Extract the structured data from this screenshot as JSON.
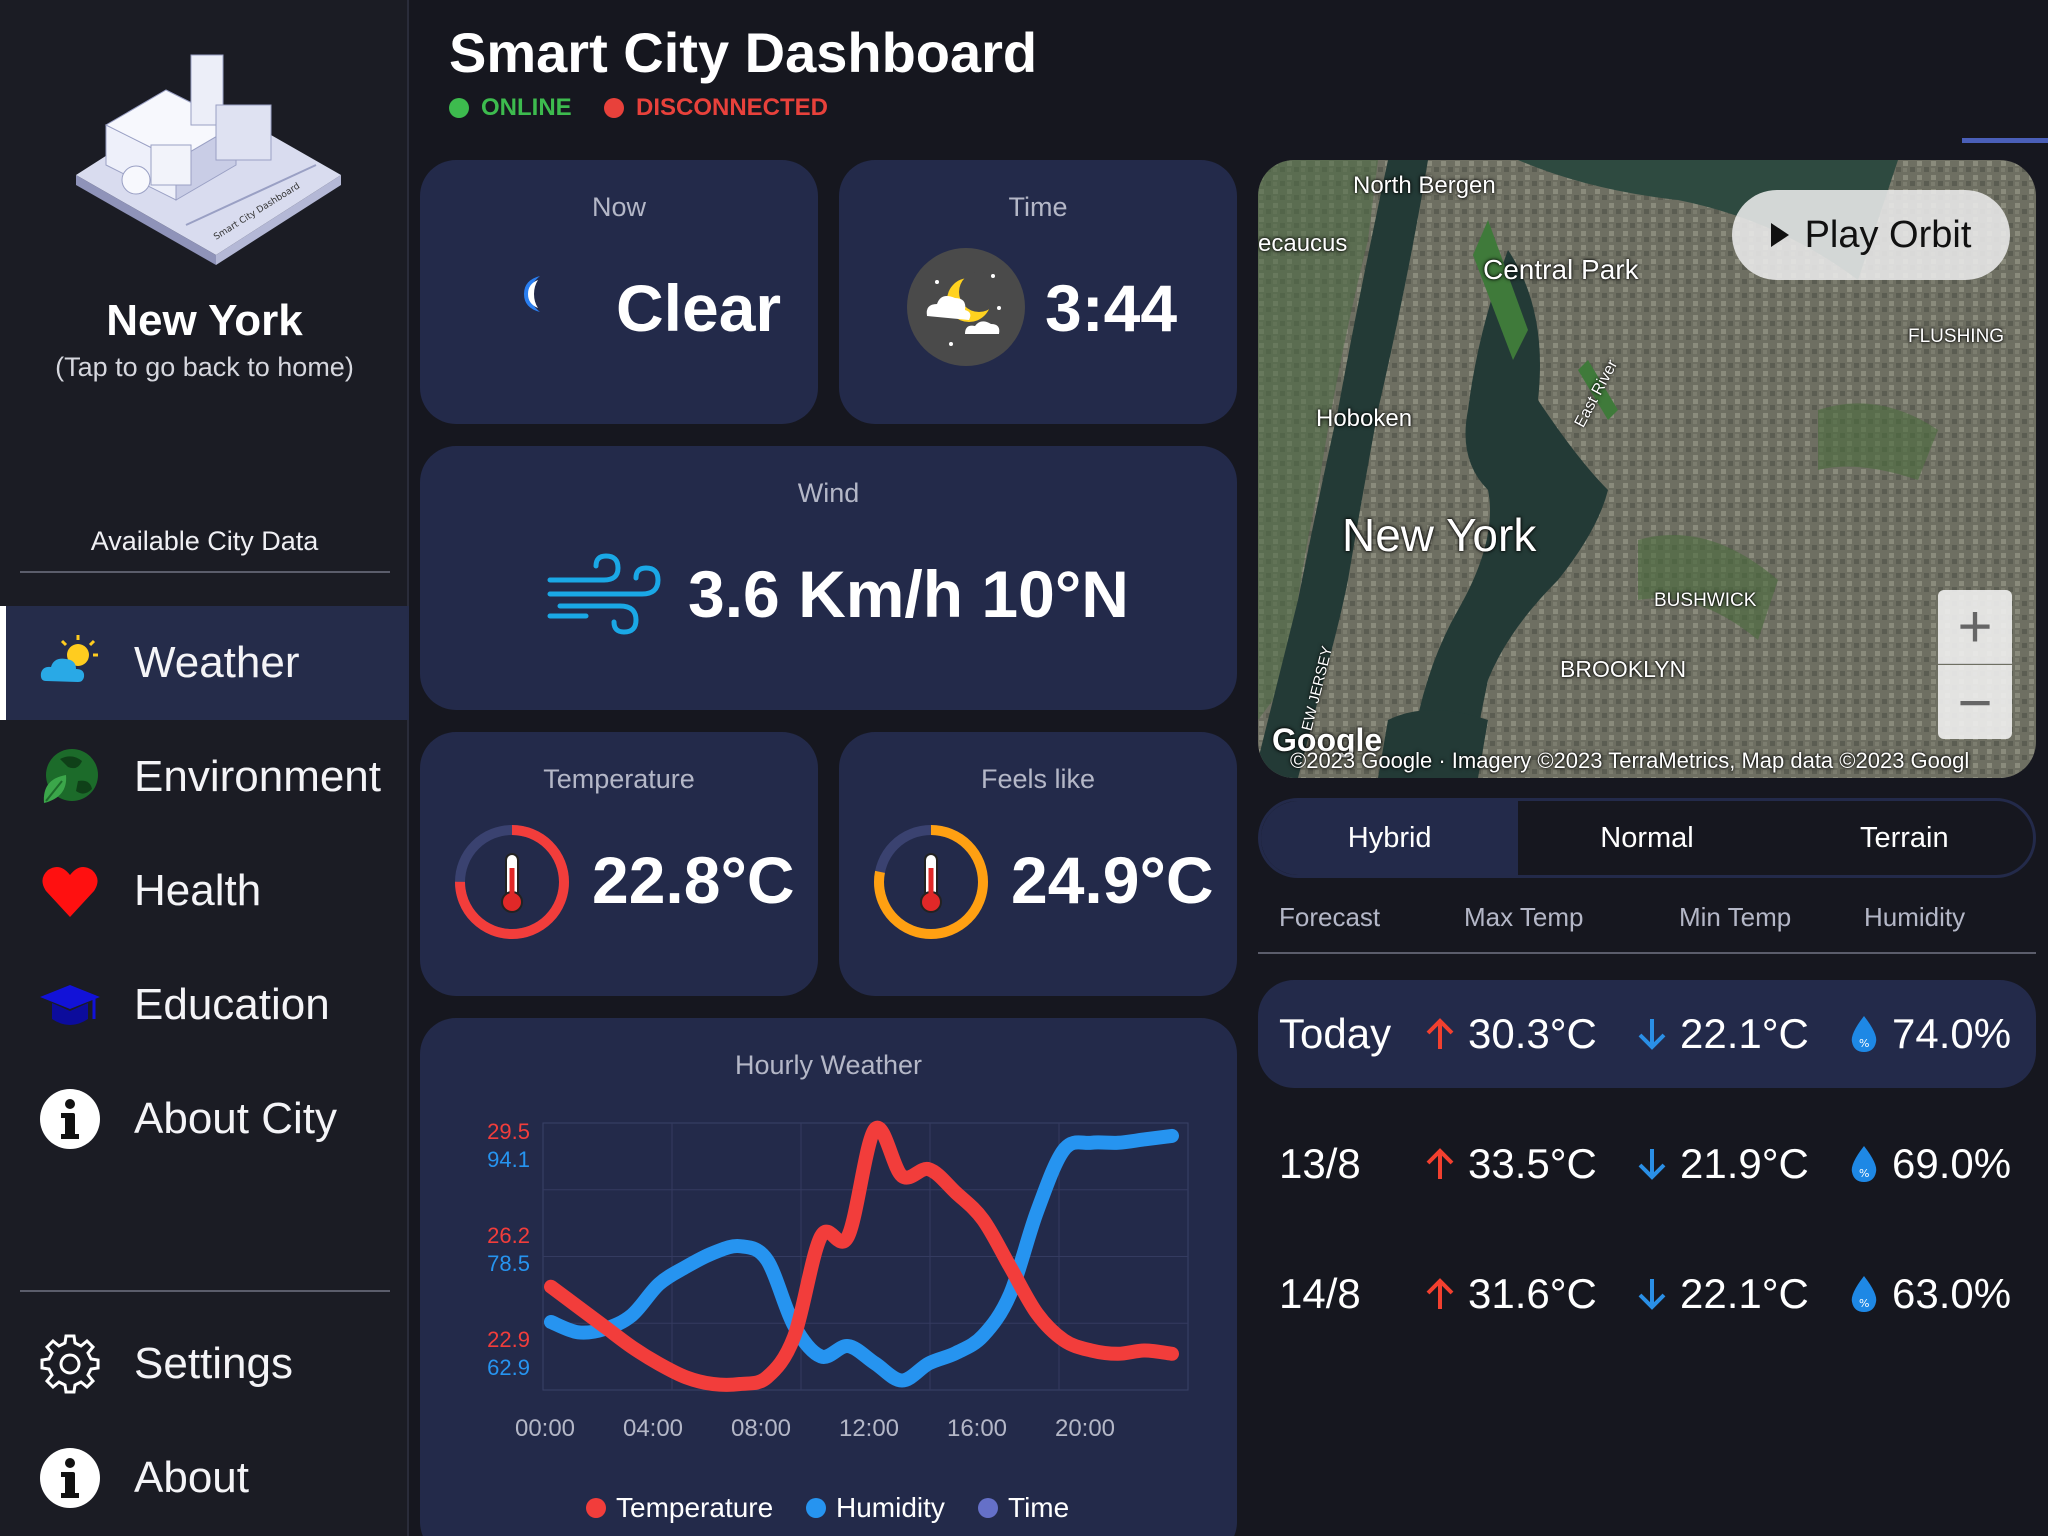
{
  "sidebar": {
    "city_name": "New York",
    "city_subtitle": "(Tap to go back to home)",
    "section_label": "Available City Data",
    "items": [
      {
        "label": "Weather",
        "icon": "weather-icon",
        "active": true
      },
      {
        "label": "Environment",
        "icon": "globe-leaf-icon"
      },
      {
        "label": "Health",
        "icon": "heart-icon"
      },
      {
        "label": "Education",
        "icon": "graduation-cap-icon"
      },
      {
        "label": "About City",
        "icon": "info-icon"
      }
    ],
    "bottom_items": [
      {
        "label": "Settings",
        "icon": "gear-icon"
      },
      {
        "label": "About",
        "icon": "info-icon"
      }
    ]
  },
  "header": {
    "title": "Smart City Dashboard",
    "status_online": "ONLINE",
    "status_disconnected": "DISCONNECTED",
    "colors": {
      "online": "#3dbb4e",
      "disconnected": "#e8413b"
    }
  },
  "cards": {
    "now": {
      "title": "Now",
      "value": "Clear"
    },
    "time": {
      "title": "Time",
      "value": "3:44"
    },
    "wind": {
      "title": "Wind",
      "value": "3.6 Km/h 10°N"
    },
    "temperature": {
      "title": "Temperature",
      "value": "22.8°C"
    },
    "feels_like": {
      "title": "Feels like",
      "value": "24.9°C"
    },
    "hourly": {
      "title": "Hourly Weather"
    }
  },
  "map": {
    "labels": [
      "North Bergen",
      "ecaucus",
      "Central Park",
      "FLUSHING",
      "Hoboken",
      "East River",
      "New York",
      "BUSHWICK",
      "BROOKLYN",
      "EW JERSEY"
    ],
    "play_label": "Play Orbit",
    "attribution_logo": "Google",
    "attribution": "©2023 Google · Imagery ©2023 TerraMetrics, Map data ©2023 Googl"
  },
  "map_types": [
    "Hybrid",
    "Normal",
    "Terrain"
  ],
  "forecast": {
    "headers": [
      "Forecast",
      "Max Temp",
      "Min Temp",
      "Humidity"
    ],
    "rows": [
      {
        "day": "Today",
        "max": "30.3°C",
        "min": "22.1°C",
        "humidity": "74.0%"
      },
      {
        "day": "13/8",
        "max": "33.5°C",
        "min": "21.9°C",
        "humidity": "69.0%"
      },
      {
        "day": "14/8",
        "max": "31.6°C",
        "min": "22.1°C",
        "humidity": "63.0%"
      }
    ]
  },
  "chart_data": {
    "type": "line",
    "title": "Hourly Weather",
    "x": [
      "00:00",
      "01:00",
      "02:00",
      "03:00",
      "04:00",
      "05:00",
      "06:00",
      "07:00",
      "08:00",
      "09:00",
      "10:00",
      "11:00",
      "12:00",
      "13:00",
      "14:00",
      "15:00",
      "16:00",
      "17:00",
      "18:00",
      "19:00",
      "20:00",
      "21:00",
      "22:00",
      "23:00"
    ],
    "x_ticks": [
      "00:00",
      "04:00",
      "08:00",
      "12:00",
      "16:00",
      "20:00"
    ],
    "series": [
      {
        "name": "Temperature",
        "color": "#f23d3b",
        "axis_ticks": [
          "29.5",
          "26.2",
          "22.9"
        ],
        "ylim": [
          22.1,
          29.7
        ],
        "values": [
          25.0,
          24.4,
          23.8,
          23.2,
          22.7,
          22.3,
          22.1,
          22.1,
          22.3,
          23.5,
          26.5,
          26.5,
          29.7,
          28.3,
          28.5,
          27.8,
          27.0,
          25.6,
          24.2,
          23.4,
          23.1,
          23.0,
          23.1,
          23.0
        ]
      },
      {
        "name": "Humidity",
        "color": "#2694f0",
        "axis_ticks": [
          "94.1",
          "78.5",
          "62.9"
        ],
        "ylim": [
          59,
          96
        ],
        "values": [
          68.0,
          66.5,
          67.0,
          69.0,
          73.5,
          76.0,
          78.0,
          79.0,
          77.0,
          67.5,
          63.0,
          64.5,
          62.0,
          59.5,
          62.0,
          63.5,
          66.0,
          72.0,
          84.0,
          93.0,
          94.0,
          94.0,
          94.5,
          95.0
        ]
      },
      {
        "name": "Time",
        "color": "#6570c8",
        "values": []
      }
    ]
  }
}
